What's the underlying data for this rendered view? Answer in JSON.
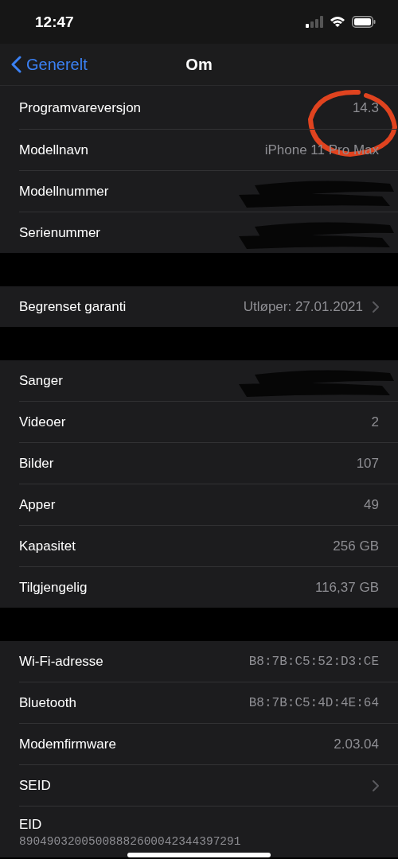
{
  "status_bar": {
    "time": "12:47"
  },
  "nav": {
    "back": "Generelt",
    "title": "Om"
  },
  "groups": [
    {
      "rows": [
        {
          "label": "Programvareversjon",
          "value": "14.3",
          "kind": "text"
        },
        {
          "label": "Modellnavn",
          "value": "iPhone 11 Pro Max",
          "kind": "text"
        },
        {
          "label": "Modellnummer",
          "kind": "text",
          "redacted": true
        },
        {
          "label": "Serienummer",
          "kind": "text",
          "redacted": true
        }
      ]
    },
    {
      "rows": [
        {
          "label": "Begrenset garanti",
          "value": "Utløper: 27.01.2021",
          "kind": "text",
          "chevron": true
        }
      ]
    },
    {
      "rows": [
        {
          "label": "Sanger",
          "kind": "text",
          "redacted": true
        },
        {
          "label": "Videoer",
          "value": "2",
          "kind": "text"
        },
        {
          "label": "Bilder",
          "value": "107",
          "kind": "text"
        },
        {
          "label": "Apper",
          "value": "49",
          "kind": "text"
        },
        {
          "label": "Kapasitet",
          "value": "256 GB",
          "kind": "text"
        },
        {
          "label": "Tilgjengelig",
          "value": "116,37 GB",
          "kind": "text"
        }
      ]
    },
    {
      "rows": [
        {
          "label": "Wi-Fi-adresse",
          "value": "B8:7B:C5:52:D3:CE",
          "kind": "mono"
        },
        {
          "label": "Bluetooth",
          "value": "B8:7B:C5:4D:4E:64",
          "kind": "mono"
        },
        {
          "label": "Modemfirmware",
          "value": "2.03.04",
          "kind": "text"
        },
        {
          "label": "SEID",
          "kind": "text",
          "chevron": true
        },
        {
          "label": "EID",
          "value": "89049032005008882600042344397291",
          "kind": "stacked"
        }
      ]
    }
  ]
}
